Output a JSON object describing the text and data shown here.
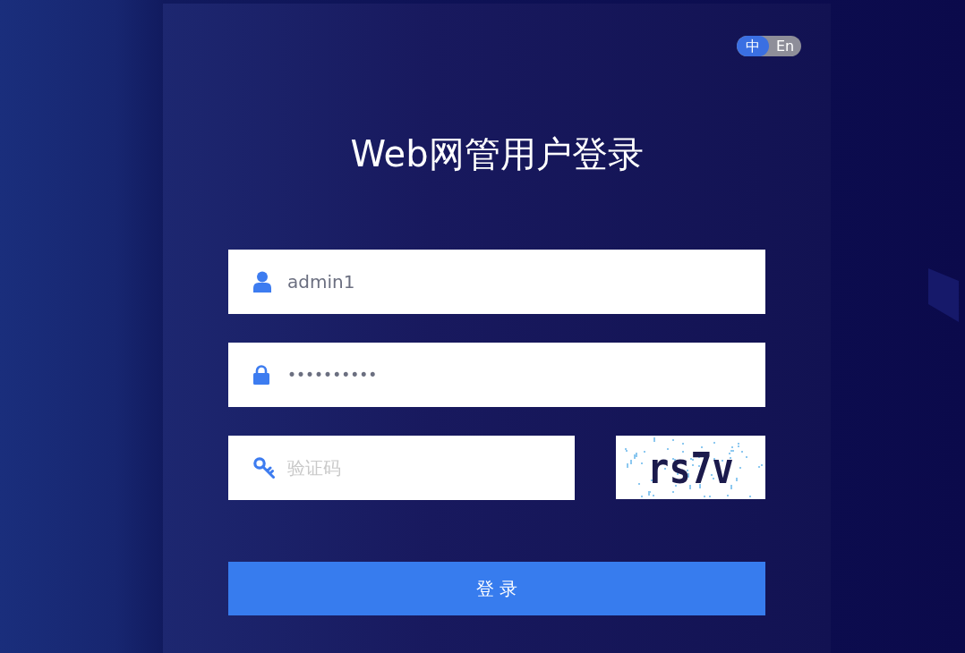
{
  "language_toggle": [
    {
      "label": "中",
      "selected": true
    },
    {
      "label": "En",
      "selected": false
    }
  ],
  "title": "Web网管用户登录",
  "fields": [
    {
      "kind": "username",
      "value": "admin1"
    },
    {
      "kind": "password",
      "value": "••••••••••"
    },
    {
      "kind": "captcha",
      "placeholder": "验证码"
    }
  ],
  "captcha": {
    "text": "rs7v"
  },
  "login_button": {
    "label": "登 录"
  }
}
